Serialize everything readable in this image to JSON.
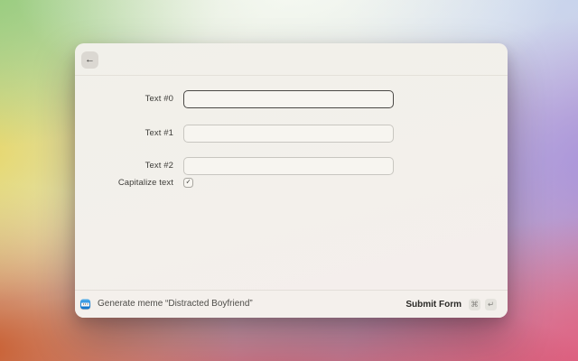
{
  "window": {
    "header": {
      "back_icon": "←"
    },
    "form": {
      "fields": [
        {
          "label": "Text #0",
          "value": "",
          "focused": true
        },
        {
          "label": "Text #1",
          "value": "",
          "focused": false
        },
        {
          "label": "Text #2",
          "value": "",
          "focused": false
        }
      ],
      "checkbox": {
        "label": "Capitalize text",
        "checked": true,
        "check_icon": "✓"
      }
    },
    "footer": {
      "action_label": "Generate meme “Distracted Boyfriend”",
      "submit_label": "Submit Form",
      "shortcut_keys": [
        "⌘",
        "↵"
      ]
    }
  },
  "colors": {
    "window_bg": "#f2f0ea",
    "input_bg": "#f7f5f0",
    "input_border_focused": "#4a4845",
    "input_border": "#c8c6c0",
    "divider": "#e4e1da",
    "extension_icon_blue": "#2088de",
    "keycap_bg": "#e5e3dd"
  }
}
